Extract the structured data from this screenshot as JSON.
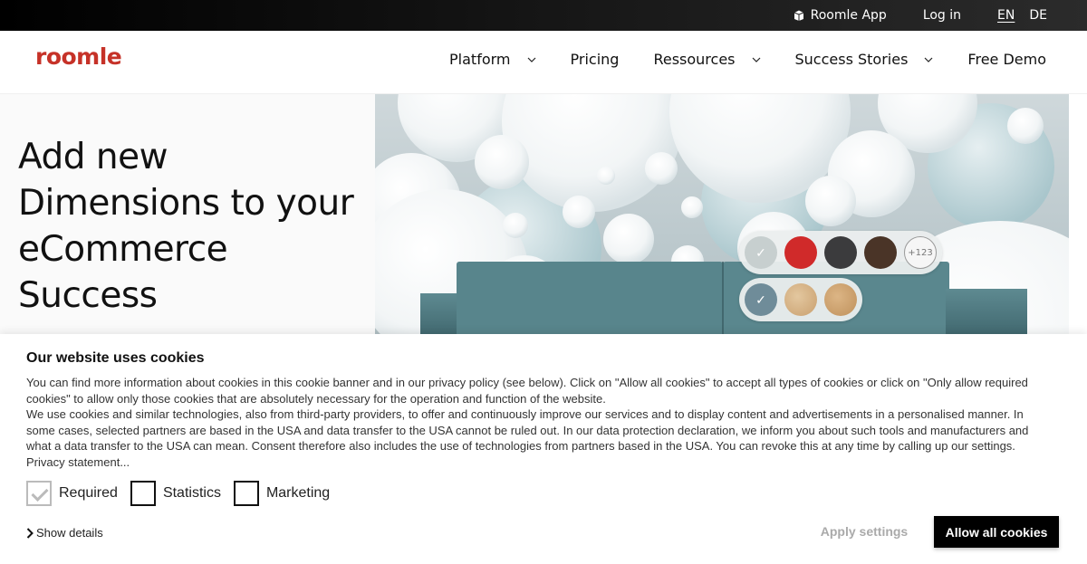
{
  "topbar": {
    "app_link": "Roomle App",
    "login": "Log in",
    "languages": [
      {
        "code": "EN",
        "active": true
      },
      {
        "code": "DE",
        "active": false
      }
    ]
  },
  "header": {
    "logo": "roomle",
    "brand_color": "#c63228",
    "nav": [
      {
        "label": "Platform",
        "has_dropdown": true
      },
      {
        "label": "Pricing",
        "has_dropdown": false
      },
      {
        "label": "Ressources",
        "has_dropdown": true
      },
      {
        "label": "Success Stories",
        "has_dropdown": true
      },
      {
        "label": "Free Demo",
        "has_dropdown": false
      }
    ]
  },
  "hero": {
    "title": "Add new Dimensions to your eCommerce Success",
    "swatches": {
      "row1": [
        {
          "color": "#c7cfcf",
          "selected": true
        },
        {
          "color": "#d02a2a",
          "selected": false
        },
        {
          "color": "#3b3b3d",
          "selected": false
        },
        {
          "color": "#4a3427",
          "selected": false
        }
      ],
      "row1_more": "+123",
      "row2": [
        {
          "color": "#6f8c99",
          "selected": true
        },
        {
          "color": "#d6b48a",
          "selected": false
        },
        {
          "color": "#cfa977",
          "selected": false
        }
      ]
    }
  },
  "cookie_banner": {
    "title": "Our website uses cookies",
    "paragraphs": [
      "You can find more information about cookies in this cookie banner and in our privacy policy (see below). Click on \"Allow all cookies\" to accept all types of cookies or click on \"Only allow required cookies\" to allow only those cookies that are absolutely necessary for the operation and function of the website.",
      "We use cookies and similar technologies, also from third-party providers, to offer and continuously improve our services and to display content and advertisements in a personalised manner. In some cases, selected partners are based in the USA and data transfer to the USA cannot be ruled out. In our data protection declaration, we inform you about such tools and manufacturers and what a data transfer to the USA can mean. Consent therefore also includes the use of technologies from partners based in the USA. You can revoke this at any time by calling up our settings.",
      "Privacy statement..."
    ],
    "checkboxes": [
      {
        "label": "Required",
        "checked": true,
        "disabled": true
      },
      {
        "label": "Statistics",
        "checked": false,
        "disabled": false
      },
      {
        "label": "Marketing",
        "checked": false,
        "disabled": false
      }
    ],
    "show_details": "Show details",
    "apply_settings": "Apply settings",
    "allow_all": "Allow all cookies"
  }
}
